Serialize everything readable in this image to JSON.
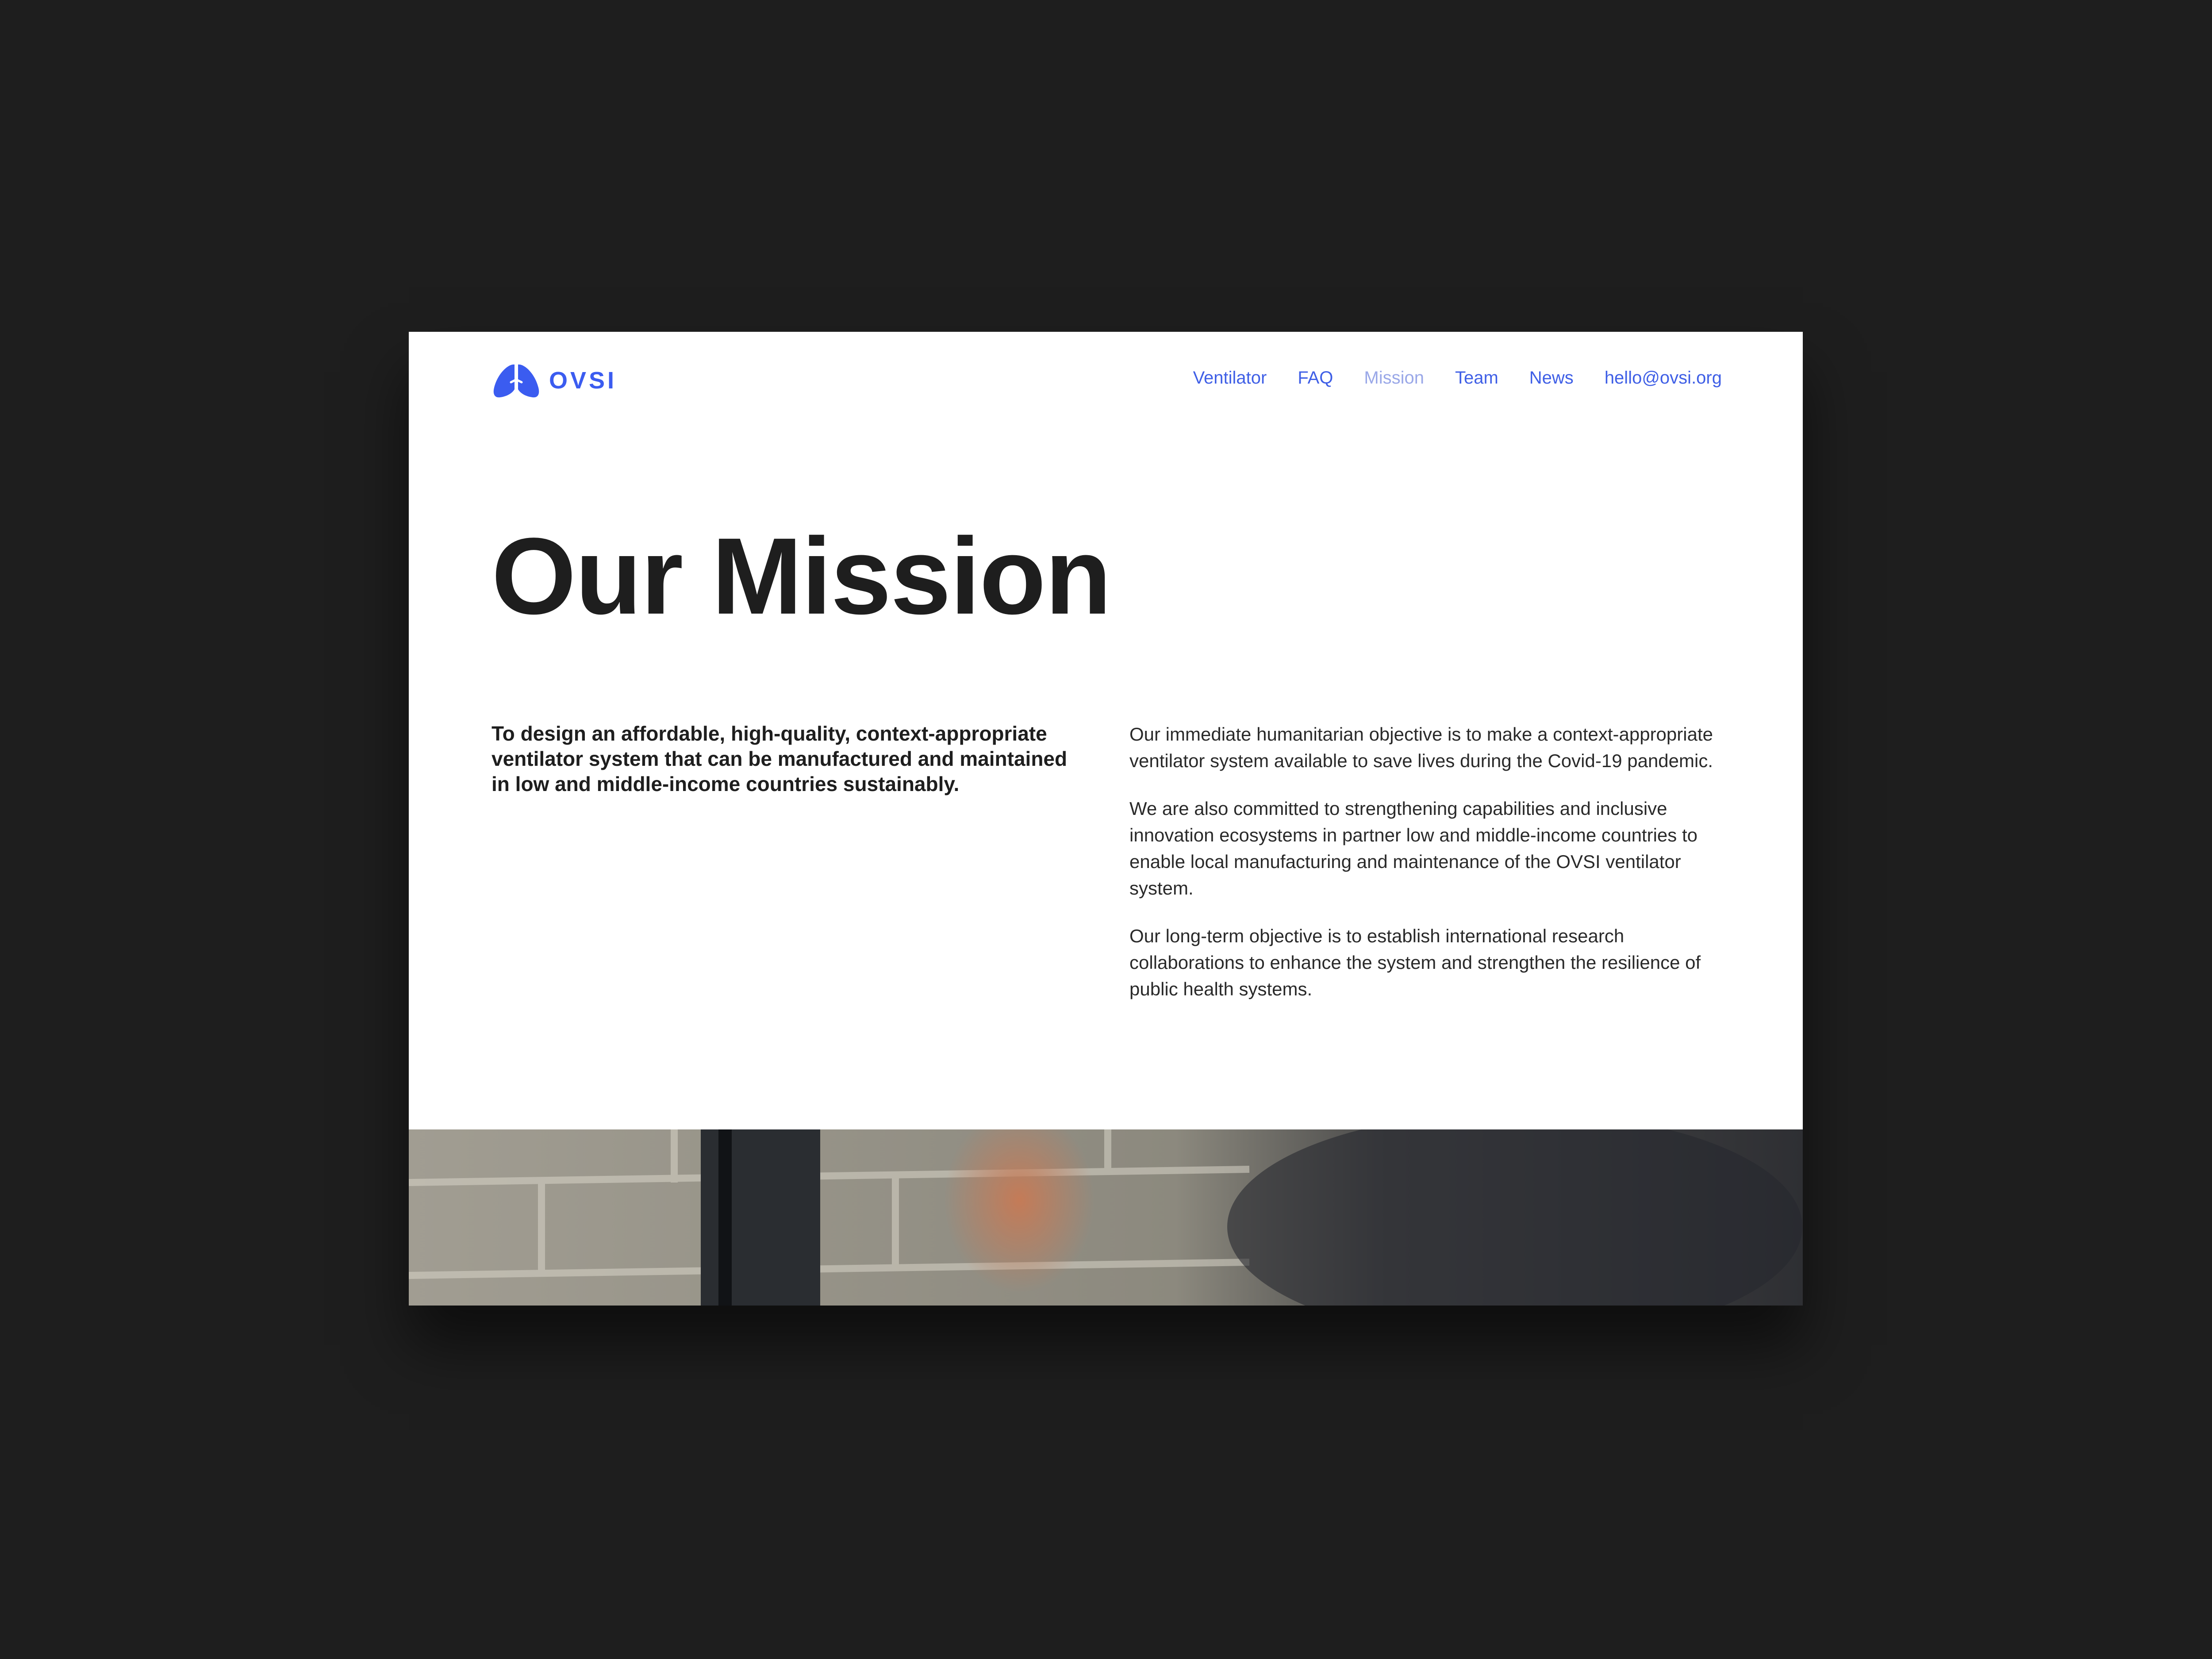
{
  "header": {
    "brand": "OVSI",
    "logo_icon": "lungs-icon",
    "brand_color": "#3b5cf0",
    "nav": [
      {
        "label": "Ventilator",
        "active": false
      },
      {
        "label": "FAQ",
        "active": false
      },
      {
        "label": "Mission",
        "active": true
      },
      {
        "label": "Team",
        "active": false
      },
      {
        "label": "News",
        "active": false
      },
      {
        "label": "hello@ovsi.org",
        "active": false
      }
    ]
  },
  "main": {
    "title": "Our Mission",
    "lead": "To design an affordable, high-quality, context-appropriate ventilator system that can be manufactured and maintained in low and middle-income countries sustainably.",
    "paragraphs": [
      "Our immediate humanitarian objective is to make a context-appropriate ventilator system available to save lives during the Covid-19 pandemic.",
      "We are also committed to strengthening capabilities and inclusive innovation ecosystems in partner low and middle-income countries to enable local manufacturing and maintenance of the OVSI ventilator system.",
      "Our long-term objective is to establish international research collaborations to enhance the system and strengthen the resilience of public health systems."
    ]
  },
  "colors": {
    "background": "#1e1e1e",
    "nav_link": "#3f5fe6",
    "nav_active": "#9aa8e8",
    "text": "#1e1e1e"
  }
}
